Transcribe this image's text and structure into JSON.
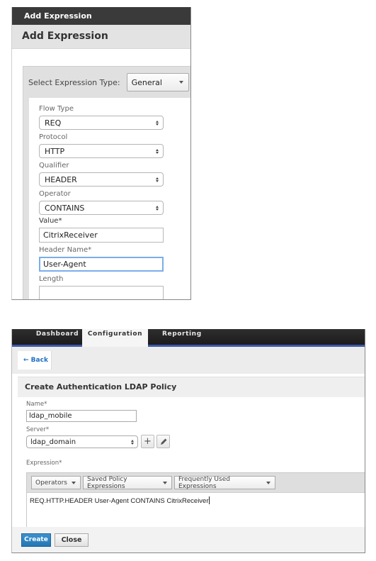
{
  "add_expression_dialog": {
    "titlebar": "Add Expression",
    "header": "Add Expression",
    "expression_type_label": "Select Expression Type:",
    "expression_type_value": "General",
    "fields": {
      "flow_type": {
        "label": "Flow Type",
        "value": "REQ"
      },
      "protocol": {
        "label": "Protocol",
        "value": "HTTP"
      },
      "qualifier": {
        "label": "Qualifier",
        "value": "HEADER"
      },
      "operator": {
        "label": "Operator",
        "value": "CONTAINS"
      },
      "value": {
        "label": "Value*",
        "value": "CitrixReceiver"
      },
      "header_name": {
        "label": "Header Name*",
        "value": "User-Agent"
      },
      "length": {
        "label": "Length",
        "value": ""
      }
    }
  },
  "ldap_policy_page": {
    "nav_tabs": [
      {
        "label": "Dashboard",
        "active": false
      },
      {
        "label": "Configuration",
        "active": true
      },
      {
        "label": "Reporting",
        "active": false
      }
    ],
    "back_label": "← Back",
    "form_title": "Create Authentication LDAP Policy",
    "name_label": "Name*",
    "name_value": "ldap_mobile",
    "server_label": "Server*",
    "server_value": "ldap_domain",
    "add_icon": "plus-icon",
    "edit_icon": "pencil-icon",
    "expression_label": "Expression*",
    "expression_dropdowns": [
      "Operators",
      "Saved Policy Expressions",
      "Frequently Used Expressions"
    ],
    "expression_value": "REQ.HTTP.HEADER User-Agent CONTAINS CitrixReceiver",
    "create_label": "Create",
    "close_label": "Close"
  }
}
